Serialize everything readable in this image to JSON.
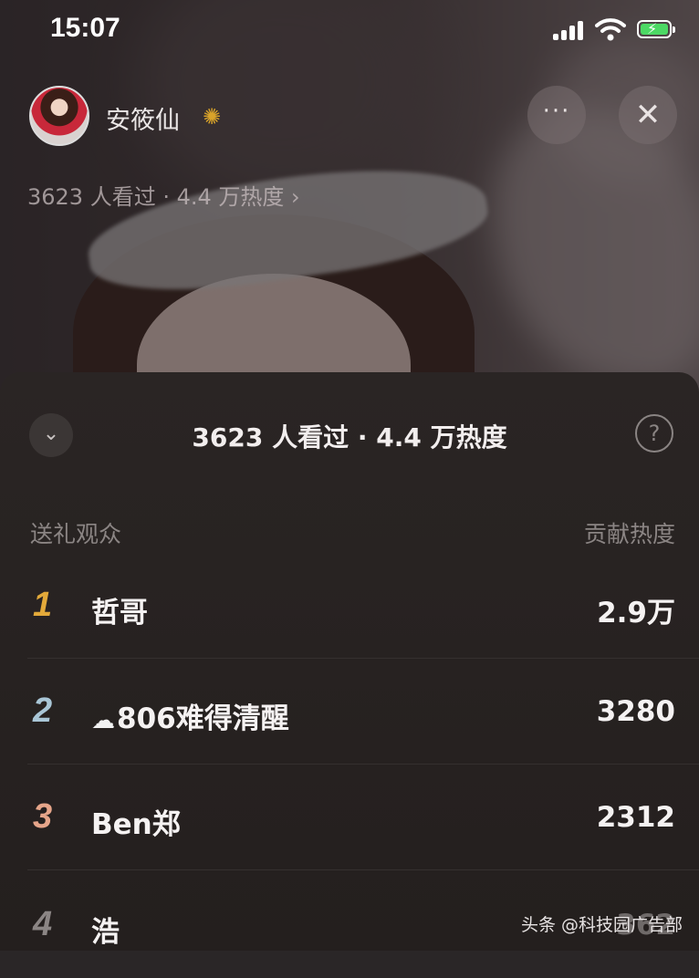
{
  "status_bar": {
    "time": "15:07"
  },
  "stream": {
    "host_name": "安筱仙",
    "stats": "3623 人看过 · 4.4 万热度 ›",
    "more_label": "···",
    "close_label": "✕"
  },
  "sheet": {
    "title": "3623 人看过 · 4.4 万热度",
    "collapse_label": "⌄",
    "help_label": "?",
    "col_left": "送礼观众",
    "col_right": "贡献热度",
    "rows": [
      {
        "rank": "1",
        "name": "哲哥",
        "value": "2.9万",
        "rank_color": "#e3a93a"
      },
      {
        "rank": "2",
        "icon": "cloud-icon",
        "name": "806难得清醒",
        "value": "3280",
        "rank_color": "#a9c6d6"
      },
      {
        "rank": "3",
        "name": "Ben郑",
        "value": "2312",
        "rank_color": "#e6a58a"
      },
      {
        "rank": "4",
        "name": "浩",
        "value": "362",
        "rank_color": "#8b8584"
      }
    ]
  },
  "watermark": "头条 @科技园广告部"
}
